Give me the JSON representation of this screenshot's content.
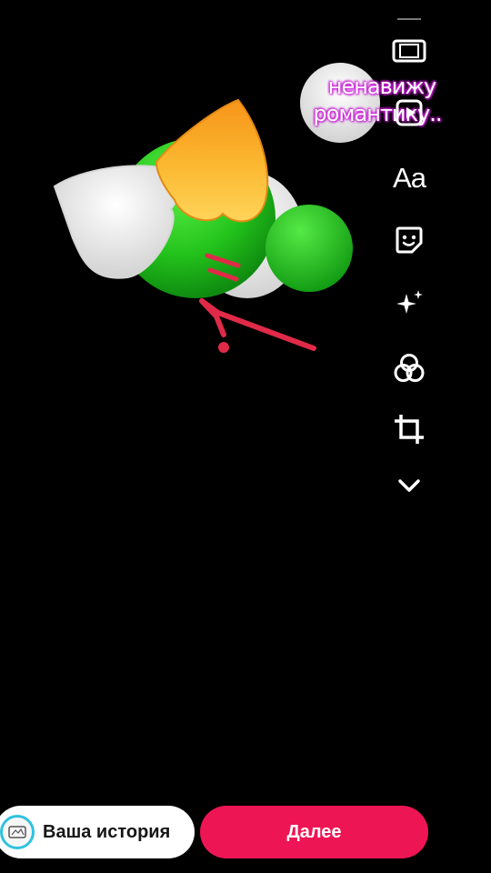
{
  "caption": {
    "line1": "ненавижу",
    "line2": "романтику..",
    "text_color": "#ffffff",
    "outline_color": "#c81fd6"
  },
  "toolbar": {
    "items": [
      {
        "icon": "tablet-icon"
      },
      {
        "icon": "video-play-icon"
      },
      {
        "icon": "text-icon",
        "label": "Aa"
      },
      {
        "icon": "sticker-icon"
      },
      {
        "icon": "sparkle-effects-icon"
      },
      {
        "icon": "filters-icon"
      },
      {
        "icon": "crop-icon"
      },
      {
        "icon": "chevron-down-icon"
      }
    ]
  },
  "bottom": {
    "story_label": "Ваша история",
    "next_label": "Далее",
    "next_color": "#ee1555"
  },
  "drawing": {
    "colors": {
      "green": "#22c51d",
      "yellow_heart": "#f7a21a",
      "white_heart": "#eeeeee",
      "red_marks": "#e02a48"
    }
  }
}
